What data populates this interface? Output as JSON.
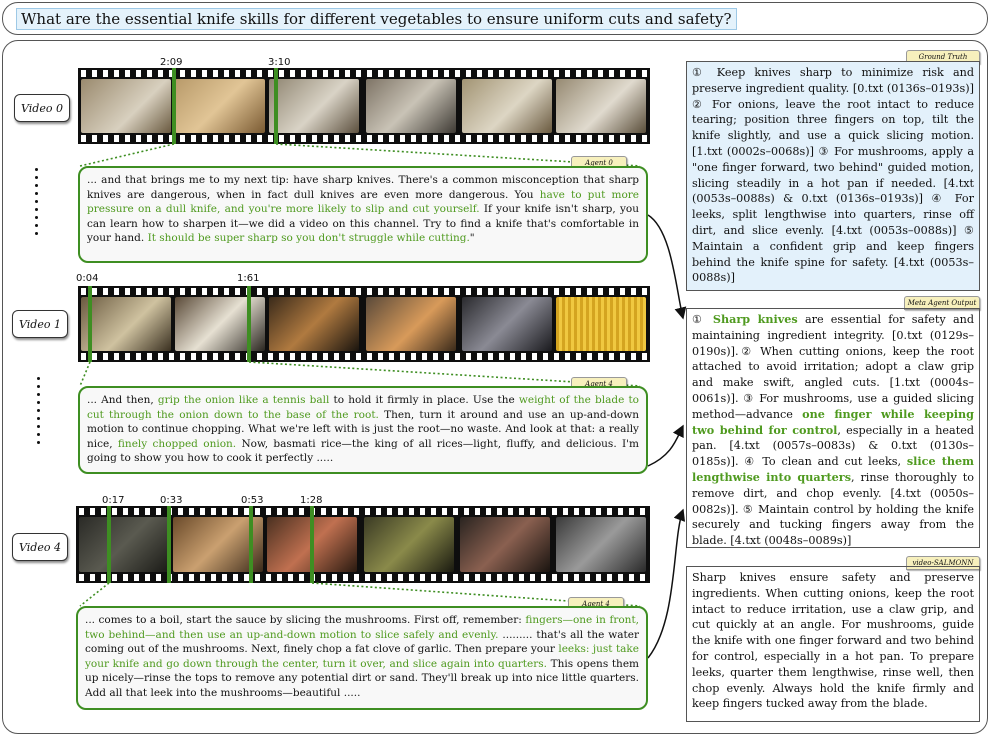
{
  "question": "What are the essential knife skills for different vegetables to ensure uniform cuts and safety?",
  "videos": [
    {
      "label": "Video 0",
      "timestamps": [
        "2:09",
        "3:10"
      ]
    },
    {
      "label": "Video 1",
      "timestamps": [
        "0:04",
        "1:61"
      ]
    },
    {
      "label": "Video 4",
      "timestamps": [
        "0:17",
        "0:33",
        "0:53",
        "1:28"
      ]
    }
  ],
  "agents": [
    {
      "tag": "Agent 0",
      "segments": [
        {
          "t": "... and that brings me to my next tip: have sharp knives. There's a common misconception that sharp knives are dangerous, when in fact dull knives are even more dangerous. You ",
          "hl": false
        },
        {
          "t": "have to put more pressure on a dull knife, and you're more likely to slip and cut yourself.",
          "hl": true
        },
        {
          "t": " If your knife isn't sharp, you can learn how to sharpen it—we did a video on this channel. Try to find a knife that's comfortable in your hand. ",
          "hl": false
        },
        {
          "t": "It should be super sharp so you don't struggle while cutting.",
          "hl": true
        },
        {
          "t": "\"",
          "hl": false
        }
      ]
    },
    {
      "tag": "Agent 4",
      "segments": [
        {
          "t": "... And then, ",
          "hl": false
        },
        {
          "t": "grip the onion like a tennis ball",
          "hl": true
        },
        {
          "t": " to hold it firmly in place. Use the ",
          "hl": false
        },
        {
          "t": "weight of the blade to cut through the onion down to the base of the root.",
          "hl": true
        },
        {
          "t": " Then, turn it around and use an up-and-down motion to continue chopping. What we're left with is just the root—no waste. And look at that: a really nice, ",
          "hl": false
        },
        {
          "t": "finely chopped onion.",
          "hl": true
        },
        {
          "t": " Now, basmati rice—the king of all rices—light, fluffy, and delicious. I'm going to show you how to cook it perfectly .....",
          "hl": false
        }
      ]
    },
    {
      "tag": "Agent 4",
      "segments": [
        {
          "t": "...  comes to a boil, start the sauce by slicing the mushrooms. First off, remember: ",
          "hl": false
        },
        {
          "t": "fingers—one in front, two behind—and then use an up-and-down motion to slice safely and evenly.",
          "hl": true
        },
        {
          "t": " ......... that's all the water coming out of the mushrooms. Next, finely chop a fat clove of garlic. Then prepare your ",
          "hl": false
        },
        {
          "t": "leeks: just take your knife and go down through the center, turn it over, and slice again into quarters.",
          "hl": true
        },
        {
          "t": " This opens them up nicely—rinse the tops to remove any potential dirt or sand. They'll break up into nice little quarters. Add all that leek into the mushrooms—beautiful .....",
          "hl": false
        }
      ]
    }
  ],
  "ground_truth": {
    "tag": "Ground Truth",
    "text": "① Keep knives sharp to minimize risk and preserve ingredient quality. [0.txt (0136s–0193s)] ② For onions, leave the root intact to reduce tearing; position three fingers on top, tilt the knife slightly, and use a quick slicing motion. [1.txt (0002s–0068s)] ③ For mushrooms, apply a \"one finger forward, two behind\" guided motion, slicing steadily in a hot pan if needed. [4.txt (0053s–0088s) & 0.txt (0136s–0193s)] ④ For leeks, split lengthwise into quarters, rinse off dirt, and slice evenly. [4.txt (0053s–0088s)] ⑤ Maintain a confident grip and keep fingers behind the knife spine for safety. [4.txt (0053s–0088s)]"
  },
  "meta_agent": {
    "tag": "Meta Agent Output",
    "segments": [
      {
        "t": "① ",
        "b": false
      },
      {
        "t": "Sharp knives",
        "b": true
      },
      {
        "t": " are essential for safety and maintaining ingredient integrity. [0.txt (0129s–0190s)].② When cutting onions, keep the root attached to avoid irritation; adopt a claw grip and make swift, angled cuts. [1.txt (0004s–0061s)]. ③ For mushrooms, use a guided slicing method—advance ",
        "b": false
      },
      {
        "t": "one finger while keeping two behind for control",
        "b": true
      },
      {
        "t": ", especially in a heated pan. [4.txt (0057s–0083s) & 0.txt (0130s–0185s)]. ④ To clean and cut leeks, ",
        "b": false
      },
      {
        "t": "slice them lengthwise into quarters",
        "b": true
      },
      {
        "t": ", rinse thoroughly to remove dirt, and chop evenly. [4.txt (0050s–0082s)]. ⑤ Maintain control by holding the knife securely and tucking fingers away from the blade. [4.txt (0048s–0089s)]",
        "b": false
      }
    ]
  },
  "video_salmonn": {
    "tag": "video-SALMONN",
    "text": "Sharp knives ensure safety and preserve ingredients. When cutting onions, keep the root intact to reduce irritation, use a claw grip, and cut quickly at an angle. For mushrooms, guide the knife with one finger forward and two behind for control, especially in a hot pan. To prepare leeks, quarter them lengthwise, rinse well, then chop evenly. Always hold the knife firmly and keep fingers tucked away from the blade."
  },
  "colors": {
    "accent_green": "#3e8e22",
    "highlight_green": "#4f9a1f",
    "ground_truth_bg": "#e3f1fb",
    "tag_bg": "#f7f0bd"
  }
}
